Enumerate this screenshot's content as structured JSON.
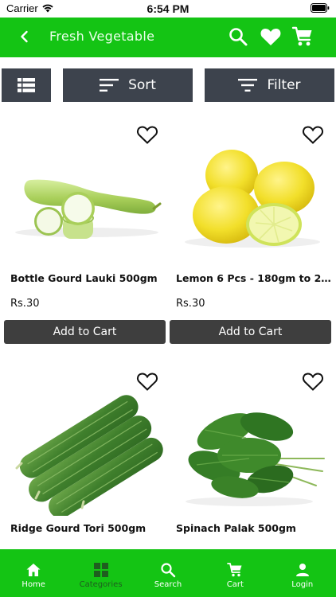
{
  "status_bar": {
    "carrier": "Carrier",
    "time": "6:54 PM"
  },
  "header": {
    "title": "Fresh Vegetable"
  },
  "toolbar": {
    "sort_label": "Sort",
    "filter_label": "Filter"
  },
  "products": [
    {
      "name": "Bottle Gourd Lauki 500gm",
      "price": "Rs.30",
      "button": "Add to Cart"
    },
    {
      "name": "Lemon 6 Pcs - 180gm to 24...",
      "price": "Rs.30",
      "button": "Add to Cart"
    },
    {
      "name": "Ridge Gourd Tori 500gm"
    },
    {
      "name": "Spinach Palak 500gm"
    }
  ],
  "bottom_nav": [
    {
      "label": "Home",
      "icon": "home-icon"
    },
    {
      "label": "Categories",
      "icon": "grid-icon",
      "active": true
    },
    {
      "label": "Search",
      "icon": "search-icon"
    },
    {
      "label": "Cart",
      "icon": "cart-icon"
    },
    {
      "label": "Login",
      "icon": "user-icon"
    }
  ],
  "colors": {
    "brand_green": "#14c414",
    "toolbar_dark": "#3d434d",
    "button_dark": "#3e3e3e"
  }
}
